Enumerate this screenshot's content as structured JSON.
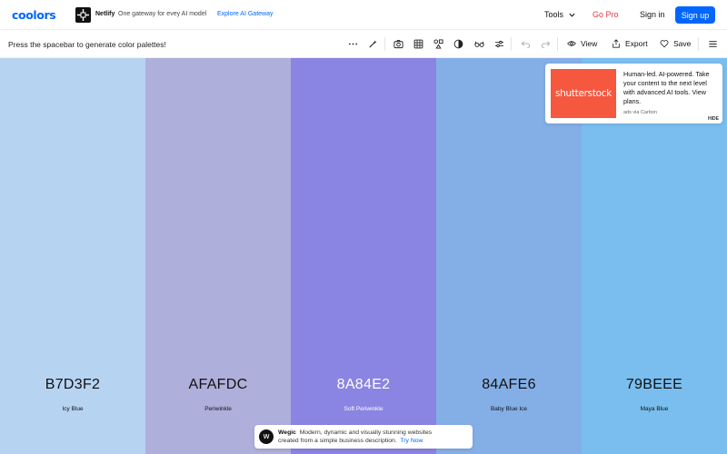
{
  "header": {
    "logo": "coolors",
    "ad": {
      "brand": "Netlify",
      "text": "One gateway for evey AI model",
      "link": "Explore AI Gateway"
    },
    "tools_label": "Tools",
    "gopro_label": "Go Pro",
    "signin_label": "Sign in",
    "signup_label": "Sign up"
  },
  "toolbar": {
    "hint": "Press the spacebar to generate color palettes!",
    "view_label": "View",
    "export_label": "Export",
    "save_label": "Save",
    "icons": [
      "more-icon",
      "magic-icon",
      "camera-icon",
      "grid-icon",
      "shapes-icon",
      "contrast-icon",
      "glasses-icon",
      "adjust-icon",
      "undo-icon",
      "redo-icon",
      "eye-icon",
      "share-icon",
      "heart-icon",
      "menu-icon"
    ]
  },
  "palette": [
    {
      "hex": "B7D3F2",
      "name": "Icy Blue",
      "color": "#B7D3F2",
      "text_color": "#111111"
    },
    {
      "hex": "AFAFDC",
      "name": "Periwinkle",
      "color": "#AFAFDC",
      "text_color": "#111111"
    },
    {
      "hex": "8A84E2",
      "name": "Soft Periwinkle",
      "color": "#8A84E2",
      "text_color": "#ffffff"
    },
    {
      "hex": "84AFE6",
      "name": "Baby Blue Ice",
      "color": "#84AFE6",
      "text_color": "#111111"
    },
    {
      "hex": "79BEEE",
      "name": "Maya Blue",
      "color": "#79BEEE",
      "text_color": "#111111"
    }
  ],
  "carbon_ad": {
    "logo_text": "shutterstock",
    "text": "Human-led. AI-powered. Take your content to the next level with advanced AI tools. View plans.",
    "via": "ads via Carbon",
    "hide_label": "HIDE"
  },
  "bottom_ad": {
    "logo": "w",
    "brand": "Wegic",
    "line1": "Modern, dynamic and visually stunning websites",
    "line2": "created from a simple business description.",
    "cta": "Try Now"
  },
  "colors": {
    "accent": "#0066ff",
    "gopro": "#e2383f"
  }
}
